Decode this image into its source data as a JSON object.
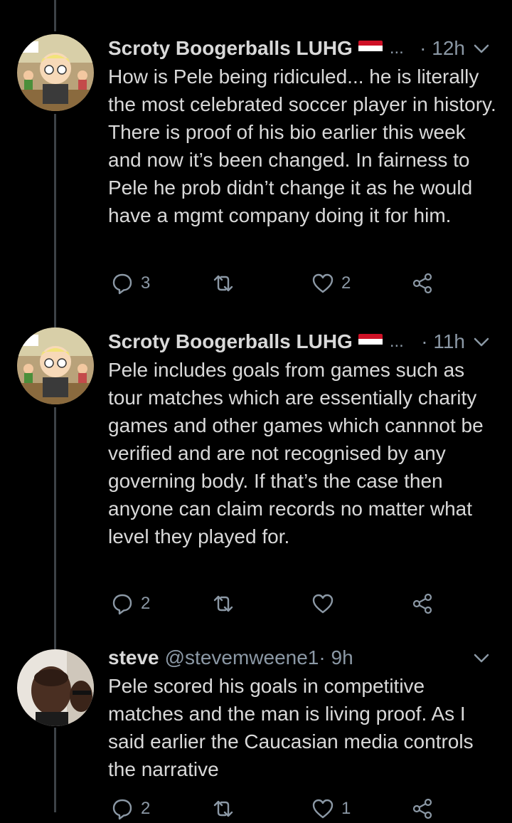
{
  "tweets": [
    {
      "name": "Scroty Boogerballs LUHG",
      "handle": "",
      "truncated": "...",
      "time": "· 12h",
      "text": "How is Pele being ridiculed... he is literally the most celebrated soccer player in history. There is proof of his bio earlier this week and now it’s been changed. In fairness to Pele he prob didn’t change it as he would have a mgmt company doing it for him.",
      "replies": "3",
      "retweets": "",
      "likes": "2",
      "avatar_icon": "cartoon-classroom-avatar"
    },
    {
      "name": "Scroty Boogerballs LUHG",
      "handle": "",
      "truncated": "...",
      "time": "· 11h",
      "text": "Pele includes goals from games such as tour matches which are essentially charity games and other games which cannnot be verified and are not recognised by any governing body. If that’s the case then anyone can claim records no matter what level they played for.",
      "replies": "2",
      "retweets": "",
      "likes": "",
      "avatar_icon": "cartoon-classroom-avatar"
    },
    {
      "name": "steve",
      "handle": "@stevemweene1",
      "truncated": "",
      "time": "· 9h",
      "text": "Pele scored his goals in competitive matches and the man is living proof. As I said earlier the Caucasian media controls the narrative",
      "replies": "2",
      "retweets": "",
      "likes": "1",
      "avatar_icon": "photo-avatar"
    }
  ],
  "colors": {
    "background": "#000000",
    "text": "#d9d9d9",
    "secondary": "#8b98a5",
    "thread_line": "#3d4247"
  },
  "icons": [
    "reply-icon",
    "retweet-icon",
    "like-icon",
    "share-icon",
    "chevron-down-icon",
    "flag-icon"
  ]
}
